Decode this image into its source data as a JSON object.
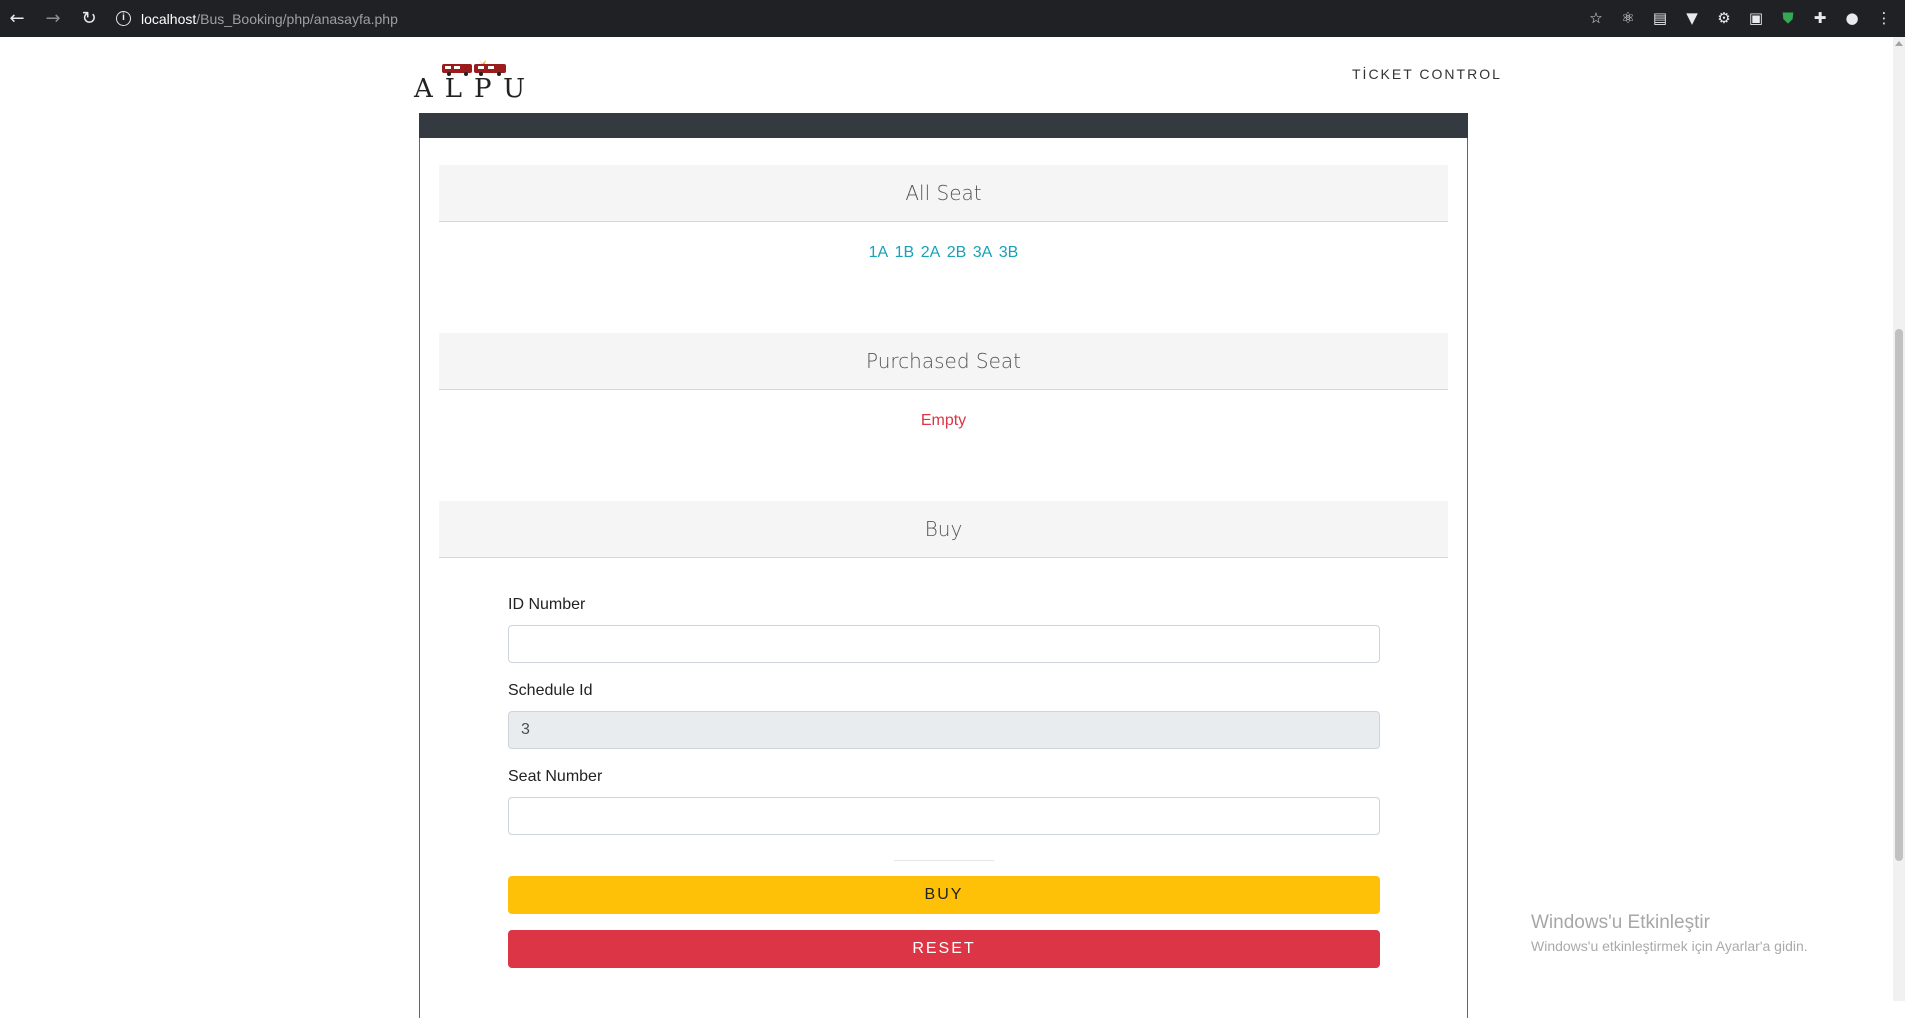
{
  "browser": {
    "url_host": "localhost",
    "url_path": "/Bus_Booking/php/anasayfa.php",
    "icons": [
      "back-arrow-icon",
      "forward-arrow-icon",
      "reload-icon",
      "site-info-icon",
      "bookmark-star-icon",
      "extension-icons",
      "puzzle-icon",
      "profile-icon",
      "menu-dots-icon"
    ]
  },
  "header": {
    "brand": "ALPU",
    "nav_link": "TİCKET CONTROL"
  },
  "sections": {
    "all_seat_title": "All Seat",
    "seats": [
      "1A",
      "1B",
      "2A",
      "2B",
      "3A",
      "3B"
    ],
    "purchased_seat_title": "Purchased Seat",
    "purchased_status": "Empty",
    "buy_title": "Buy"
  },
  "form": {
    "id_label": "ID Number",
    "id_value": "",
    "schedule_label": "Schedule Id",
    "schedule_value": "3",
    "seat_label": "Seat Number",
    "seat_value": "",
    "buy_button": "BUY",
    "reset_button": "RESET"
  },
  "watermark": {
    "line1": "Windows'u Etkinleştir",
    "line2": "Windows'u etkinleştirmek için Ayarlar'a gidin."
  },
  "colors": {
    "accent_seat": "#17a2b8",
    "danger": "#dc3545",
    "warning": "#ffc107",
    "dark": "#343a40"
  }
}
